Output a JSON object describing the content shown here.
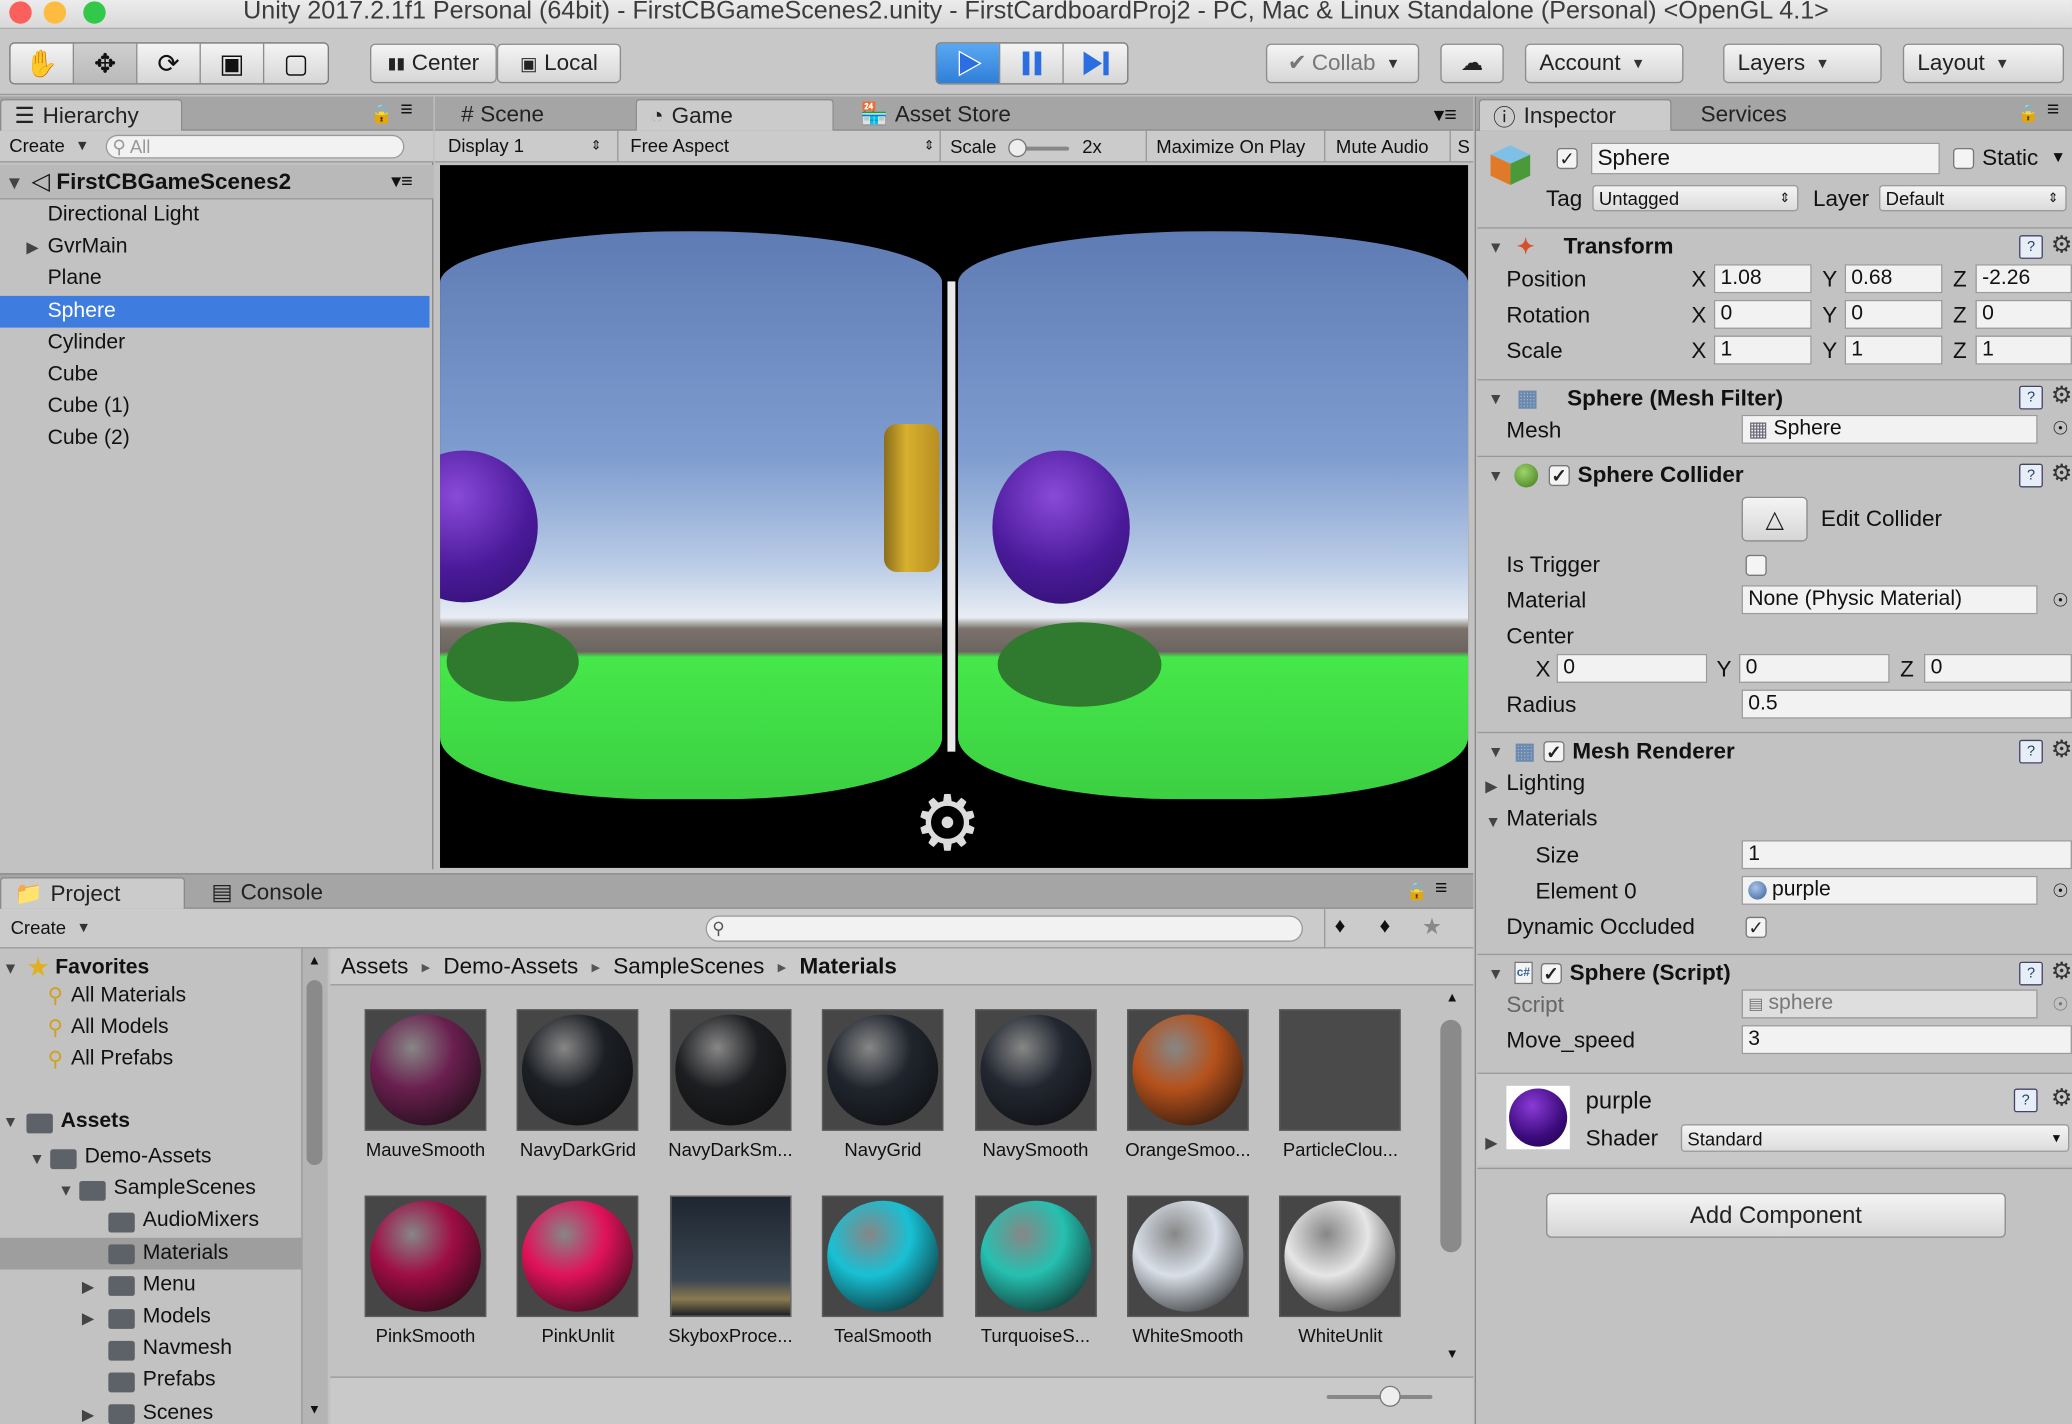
{
  "window": {
    "title": "Unity 2017.2.1f1 Personal (64bit) - FirstCBGameScenes2.unity - FirstCardboardProj2 - PC, Mac & Linux Standalone (Personal) <OpenGL 4.1>"
  },
  "toolbar": {
    "tools": [
      "hand-tool",
      "move-tool",
      "rotate-tool",
      "scale-tool",
      "rect-tool"
    ],
    "pivot_label": "Center",
    "space_label": "Local",
    "collab_label": "Collab",
    "account_label": "Account",
    "layers_label": "Layers",
    "layout_label": "Layout"
  },
  "hierarchy": {
    "tab_label": "Hierarchy",
    "create_label": "Create",
    "search_placeholder": "All",
    "scene_name": "FirstCBGameScenes2",
    "items": [
      {
        "label": "Directional Light"
      },
      {
        "label": "GvrMain"
      },
      {
        "label": "Plane"
      },
      {
        "label": "Sphere",
        "selected": true
      },
      {
        "label": "Cylinder"
      },
      {
        "label": "Cube"
      },
      {
        "label": "Cube (1)"
      },
      {
        "label": "Cube (2)"
      }
    ]
  },
  "view": {
    "tabs": [
      "Scene",
      "Game",
      "Asset Store"
    ],
    "active_tab": "Game",
    "display": "Display 1",
    "aspect": "Free Aspect",
    "scale_label": "Scale",
    "scale_value": "2x",
    "maximize_label": "Maximize On Play",
    "mute_label": "Mute Audio",
    "overflow_label": "S"
  },
  "inspector": {
    "tabs": [
      "Inspector",
      "Services"
    ],
    "object_name": "Sphere",
    "static_label": "Static",
    "tag_label": "Tag",
    "tag_value": "Untagged",
    "layer_label": "Layer",
    "layer_value": "Default",
    "transform": {
      "title": "Transform",
      "rows": [
        {
          "label": "Position",
          "x": "1.08",
          "y": "0.68",
          "z": "-2.26"
        },
        {
          "label": "Rotation",
          "x": "0",
          "y": "0",
          "z": "0"
        },
        {
          "label": "Scale",
          "x": "1",
          "y": "1",
          "z": "1"
        }
      ]
    },
    "mesh_filter": {
      "title": "Sphere (Mesh Filter)",
      "mesh_label": "Mesh",
      "mesh_value": "Sphere"
    },
    "collider": {
      "title": "Sphere Collider",
      "edit_label": "Edit Collider",
      "trigger_label": "Is Trigger",
      "material_label": "Material",
      "material_value": "None (Physic Material)",
      "center_label": "Center",
      "cx": "0",
      "cy": "0",
      "cz": "0",
      "radius_label": "Radius",
      "radius_value": "0.5"
    },
    "renderer": {
      "title": "Mesh Renderer",
      "lighting_label": "Lighting",
      "materials_label": "Materials",
      "size_label": "Size",
      "size_value": "1",
      "element_label": "Element 0",
      "element_value": "purple",
      "dyn_label": "Dynamic Occluded"
    },
    "script": {
      "title": "Sphere (Script)",
      "script_label": "Script",
      "script_value": "sphere",
      "speed_label": "Move_speed",
      "speed_value": "3"
    },
    "material": {
      "name": "purple",
      "shader_label": "Shader",
      "shader_value": "Standard"
    },
    "add_component_label": "Add Component",
    "axis": {
      "x": "X",
      "y": "Y",
      "z": "Z"
    }
  },
  "project": {
    "tabs": [
      "Project",
      "Console"
    ],
    "create_label": "Create",
    "favorites_label": "Favorites",
    "favorites": [
      "All Materials",
      "All Models",
      "All Prefabs"
    ],
    "assets_label": "Assets",
    "tree": [
      {
        "label": "Demo-Assets",
        "depth": 1
      },
      {
        "label": "SampleScenes",
        "depth": 2
      },
      {
        "label": "AudioMixers",
        "depth": 3
      },
      {
        "label": "Materials",
        "depth": 3,
        "selected": true
      },
      {
        "label": "Menu",
        "depth": 3
      },
      {
        "label": "Models",
        "depth": 3
      },
      {
        "label": "Navmesh",
        "depth": 3
      },
      {
        "label": "Prefabs",
        "depth": 3
      },
      {
        "label": "Scenes",
        "depth": 3
      }
    ],
    "breadcrumb": [
      "Assets",
      "Demo-Assets",
      "SampleScenes",
      "Materials"
    ],
    "assets": [
      {
        "name": "MauveSmooth",
        "color": "#6a1f4f"
      },
      {
        "name": "NavyDarkGrid",
        "color": "#1c1f24"
      },
      {
        "name": "NavyDarkSm...",
        "color": "#1d1e21"
      },
      {
        "name": "NavyGrid",
        "color": "#20252e"
      },
      {
        "name": "NavySmooth",
        "color": "#222731"
      },
      {
        "name": "OrangeSmoo...",
        "color": "#b5511b"
      },
      {
        "name": "ParticleClou...",
        "color": "#4a4a4a"
      },
      {
        "name": "PinkSmooth",
        "color": "#9e0d44"
      },
      {
        "name": "PinkUnlit",
        "color": "#e0125a"
      },
      {
        "name": "SkyboxProce...",
        "color": "#2e3944"
      },
      {
        "name": "TealSmooth",
        "color": "#18c0d4"
      },
      {
        "name": "TurquoiseS...",
        "color": "#25c0b0"
      },
      {
        "name": "WhiteSmooth",
        "color": "#d8dfe8"
      },
      {
        "name": "WhiteUnlit",
        "color": "#e6e6e6"
      }
    ]
  },
  "colors": {
    "selection": "#3e7ce0",
    "play_button": "#3a8ee8",
    "sphere": "#4a1a9a",
    "ground": "#45e84a",
    "cylinder": "#c9a227"
  }
}
